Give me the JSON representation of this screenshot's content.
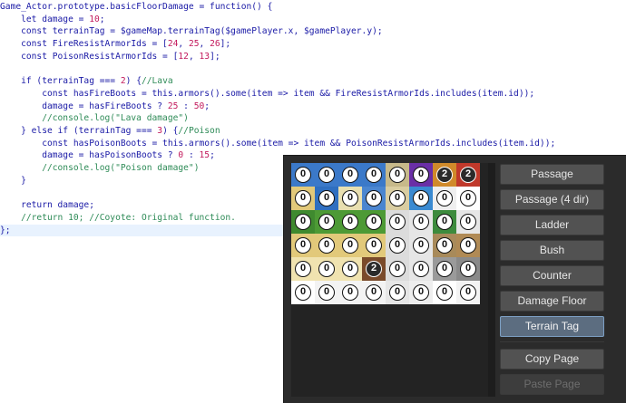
{
  "editor": {
    "lines": [
      [
        {
          "t": "Game_Actor.prototype.basicFloorDamage = function() {",
          "c": "plain"
        }
      ],
      [
        {
          "t": "    let damage = ",
          "c": "plain"
        },
        {
          "t": "10",
          "c": "num"
        },
        {
          "t": ";",
          "c": "plain"
        }
      ],
      [
        {
          "t": "    const terrainTag = $gameMap.terrainTag($gamePlayer.x, $gamePlayer.y);",
          "c": "plain"
        }
      ],
      [
        {
          "t": "    const FireResistArmorIds = [",
          "c": "plain"
        },
        {
          "t": "24",
          "c": "num"
        },
        {
          "t": ", ",
          "c": "plain"
        },
        {
          "t": "25",
          "c": "num"
        },
        {
          "t": ", ",
          "c": "plain"
        },
        {
          "t": "26",
          "c": "num"
        },
        {
          "t": "];",
          "c": "plain"
        }
      ],
      [
        {
          "t": "    const PoisonResistArmorIds = [",
          "c": "plain"
        },
        {
          "t": "12",
          "c": "num"
        },
        {
          "t": ", ",
          "c": "plain"
        },
        {
          "t": "13",
          "c": "num"
        },
        {
          "t": "];",
          "c": "plain"
        }
      ],
      [
        {
          "t": "",
          "c": "plain"
        }
      ],
      [
        {
          "t": "    if (terrainTag === ",
          "c": "plain"
        },
        {
          "t": "2",
          "c": "num"
        },
        {
          "t": ") {",
          "c": "plain"
        },
        {
          "t": "//Lava",
          "c": "cm"
        }
      ],
      [
        {
          "t": "        const hasFireBoots = this.armors().some(item => item && FireResistArmorIds.includes(item.id));",
          "c": "plain"
        }
      ],
      [
        {
          "t": "        damage = hasFireBoots ? ",
          "c": "plain"
        },
        {
          "t": "25",
          "c": "num"
        },
        {
          "t": " : ",
          "c": "plain"
        },
        {
          "t": "50",
          "c": "num"
        },
        {
          "t": ";",
          "c": "plain"
        }
      ],
      [
        {
          "t": "        //console.log(\"Lava damage\")",
          "c": "cm"
        }
      ],
      [
        {
          "t": "    } else if (terrainTag === ",
          "c": "plain"
        },
        {
          "t": "3",
          "c": "num"
        },
        {
          "t": ") {",
          "c": "plain"
        },
        {
          "t": "//Poison",
          "c": "cm"
        }
      ],
      [
        {
          "t": "        const hasPoisonBoots = this.armors().some(item => item && PoisonResistArmorIds.includes(item.id));",
          "c": "plain"
        }
      ],
      [
        {
          "t": "        damage = hasPoisonBoots ? ",
          "c": "plain"
        },
        {
          "t": "0",
          "c": "num"
        },
        {
          "t": " : ",
          "c": "plain"
        },
        {
          "t": "15",
          "c": "num"
        },
        {
          "t": ";",
          "c": "plain"
        }
      ],
      [
        {
          "t": "        //console.log(\"Poison damage\")",
          "c": "cm"
        }
      ],
      [
        {
          "t": "    }",
          "c": "plain"
        }
      ],
      [
        {
          "t": "",
          "c": "plain"
        }
      ],
      [
        {
          "t": "    return damage;",
          "c": "plain"
        }
      ],
      [
        {
          "t": "    //return 10; //Coyote: Original function.",
          "c": "cm"
        }
      ],
      [
        {
          "t": "};",
          "c": "plain"
        }
      ]
    ],
    "highlighted_line": 18
  },
  "tileset": {
    "tiles": [
      [
        "0",
        "0",
        "0",
        "0",
        "0",
        "0",
        "2",
        "2"
      ],
      [
        "0",
        "0",
        "0",
        "0",
        "0",
        "0",
        "0",
        "0"
      ],
      [
        "0",
        "0",
        "0",
        "0",
        "0",
        "0",
        "0",
        "0"
      ],
      [
        "0",
        "0",
        "0",
        "0",
        "0",
        "0",
        "0",
        "0"
      ],
      [
        "0",
        "0",
        "0",
        "2",
        "0",
        "0",
        "0",
        "0"
      ],
      [
        "0",
        "0",
        "0",
        "0",
        "0",
        "0",
        "0",
        "0"
      ]
    ],
    "colors": [
      [
        "#3b79c9",
        "#3b79c9",
        "#3b79c9",
        "#3b79c9",
        "#c7b98a",
        "#6a2fa6",
        "#d08a2a",
        "#c0392b"
      ],
      [
        "#e2c97a",
        "#2f6fc0",
        "#e8dfb0",
        "#4b86d0",
        "#d9cda1",
        "#3a8ad1",
        "#efefef",
        "#ffffff"
      ],
      [
        "#3f8a2f",
        "#4d9a35",
        "#4d9a35",
        "#4d9a35",
        "#dcdcdc",
        "#e6e6e6",
        "#3d8b3d",
        "#e6e6e6"
      ],
      [
        "#e2c97a",
        "#e2c97a",
        "#e2c97a",
        "#e2c97a",
        "#dcdcdc",
        "#e6e6e6",
        "#a88a5a",
        "#b08a55"
      ],
      [
        "#f0e3b0",
        "#f0e3b0",
        "#f0e3b0",
        "#7a4a2a",
        "#dcdcdc",
        "#e6e6e6",
        "#9a9a9a",
        "#8a8a8a"
      ],
      [
        "#ffffff",
        "#f3f3f3",
        "#f3f3f3",
        "#f3f3f3",
        "#e6e6e6",
        "#eeeeee",
        "#ffffff",
        "#f3f3f3"
      ]
    ]
  },
  "buttons": [
    {
      "label": "Passage",
      "state": "normal"
    },
    {
      "label": "Passage (4 dir)",
      "state": "normal"
    },
    {
      "label": "Ladder",
      "state": "normal"
    },
    {
      "label": "Bush",
      "state": "normal"
    },
    {
      "label": "Counter",
      "state": "normal"
    },
    {
      "label": "Damage Floor",
      "state": "normal"
    },
    {
      "label": "Terrain Tag",
      "state": "active"
    },
    {
      "label": "Copy Page",
      "state": "normal"
    },
    {
      "label": "Paste Page",
      "state": "disabled"
    }
  ]
}
